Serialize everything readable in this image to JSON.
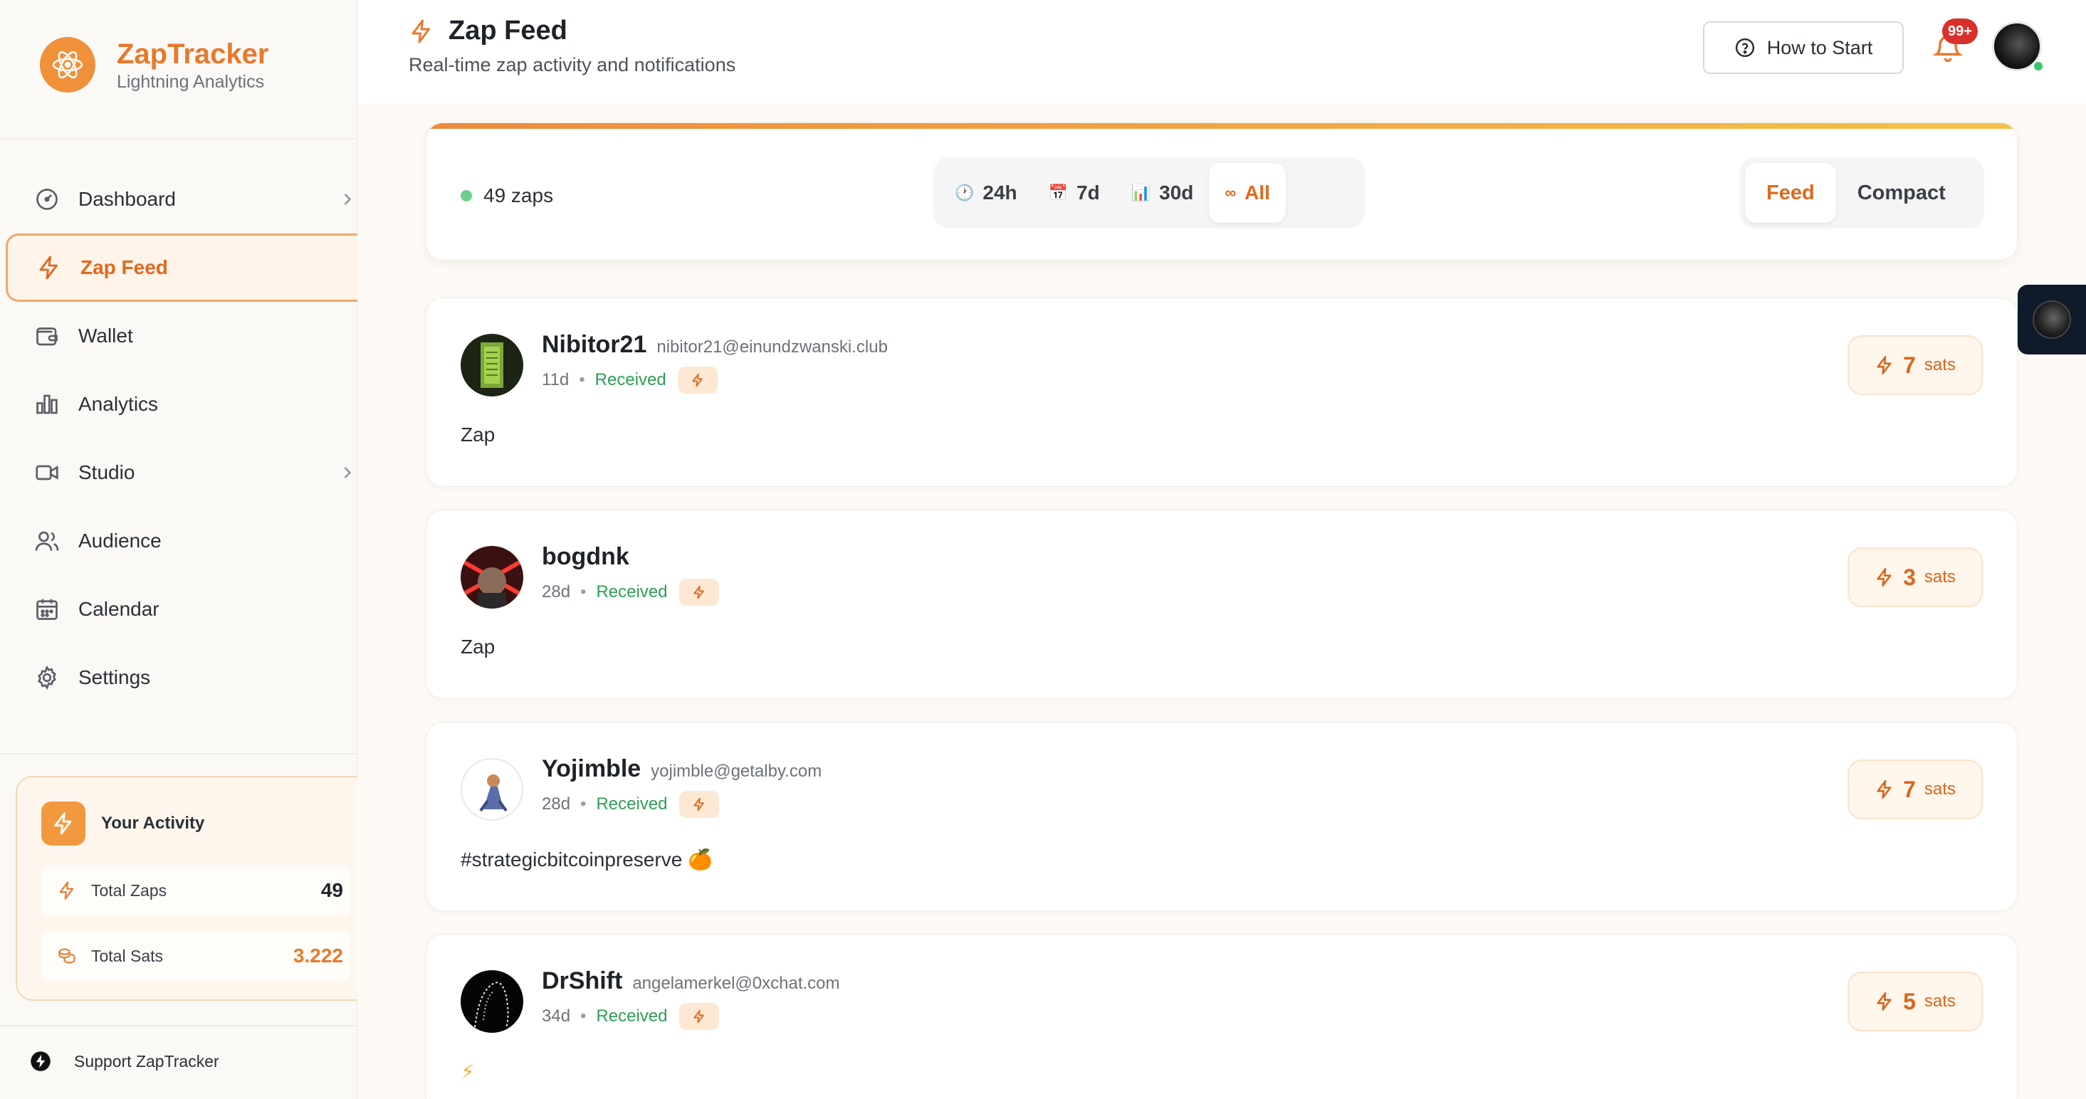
{
  "brand": {
    "name": "ZapTracker",
    "tagline": "Lightning Analytics"
  },
  "sidebar": {
    "items": [
      {
        "label": "Dashboard",
        "icon": "gauge-icon",
        "has_chevron": true,
        "active": false
      },
      {
        "label": "Zap Feed",
        "icon": "bolt-icon",
        "has_chevron": false,
        "active": true
      },
      {
        "label": "Wallet",
        "icon": "wallet-icon",
        "has_chevron": false,
        "active": false
      },
      {
        "label": "Analytics",
        "icon": "bar-chart-icon",
        "has_chevron": false,
        "active": false
      },
      {
        "label": "Studio",
        "icon": "video-icon",
        "has_chevron": true,
        "active": false
      },
      {
        "label": "Audience",
        "icon": "users-icon",
        "has_chevron": false,
        "active": false
      },
      {
        "label": "Calendar",
        "icon": "calendar-icon",
        "has_chevron": false,
        "active": false
      },
      {
        "label": "Settings",
        "icon": "gear-icon",
        "has_chevron": false,
        "active": false
      }
    ],
    "activity": {
      "title": "Your Activity",
      "total_zaps_label": "Total Zaps",
      "total_zaps_value": "49",
      "total_sats_label": "Total Sats",
      "total_sats_value": "3.222"
    },
    "support_label": "Support ZapTracker"
  },
  "header": {
    "title": "Zap Feed",
    "subtitle": "Real-time zap activity and notifications",
    "how_to_start_label": "How to Start",
    "notification_badge": "99+"
  },
  "toolbar": {
    "zap_count": "49 zaps",
    "ranges": [
      {
        "label": "24h",
        "icon": "🕐",
        "active": false
      },
      {
        "label": "7d",
        "icon": "📅",
        "active": false
      },
      {
        "label": "30d",
        "icon": "📊",
        "active": false
      },
      {
        "label": "All",
        "icon": "∞",
        "active": true
      }
    ],
    "views": [
      {
        "label": "Feed",
        "active": true
      },
      {
        "label": "Compact",
        "active": false
      }
    ]
  },
  "zaps": [
    {
      "name": "Nibitor21",
      "nip05": "nibitor21@einundzwanski.club",
      "age": "11d",
      "status": "Received",
      "message": "Zap",
      "amount": "7",
      "unit": "sats"
    },
    {
      "name": "bogdnk",
      "nip05": "",
      "age": "28d",
      "status": "Received",
      "message": "Zap",
      "amount": "3",
      "unit": "sats"
    },
    {
      "name": "Yojimble",
      "nip05": "yojimble@getalby.com",
      "age": "28d",
      "status": "Received",
      "message": "#strategicbitcoinpreserve 🍊",
      "amount": "7",
      "unit": "sats"
    },
    {
      "name": "DrShift",
      "nip05": "angelamerkel@0xchat.com",
      "age": "34d",
      "status": "Received",
      "message": "⚡",
      "amount": "5",
      "unit": "sats"
    }
  ],
  "colors": {
    "accent": "#e8792c",
    "received": "#2f9e55",
    "badge": "#d9302b",
    "sats_total": "#e8792c"
  }
}
